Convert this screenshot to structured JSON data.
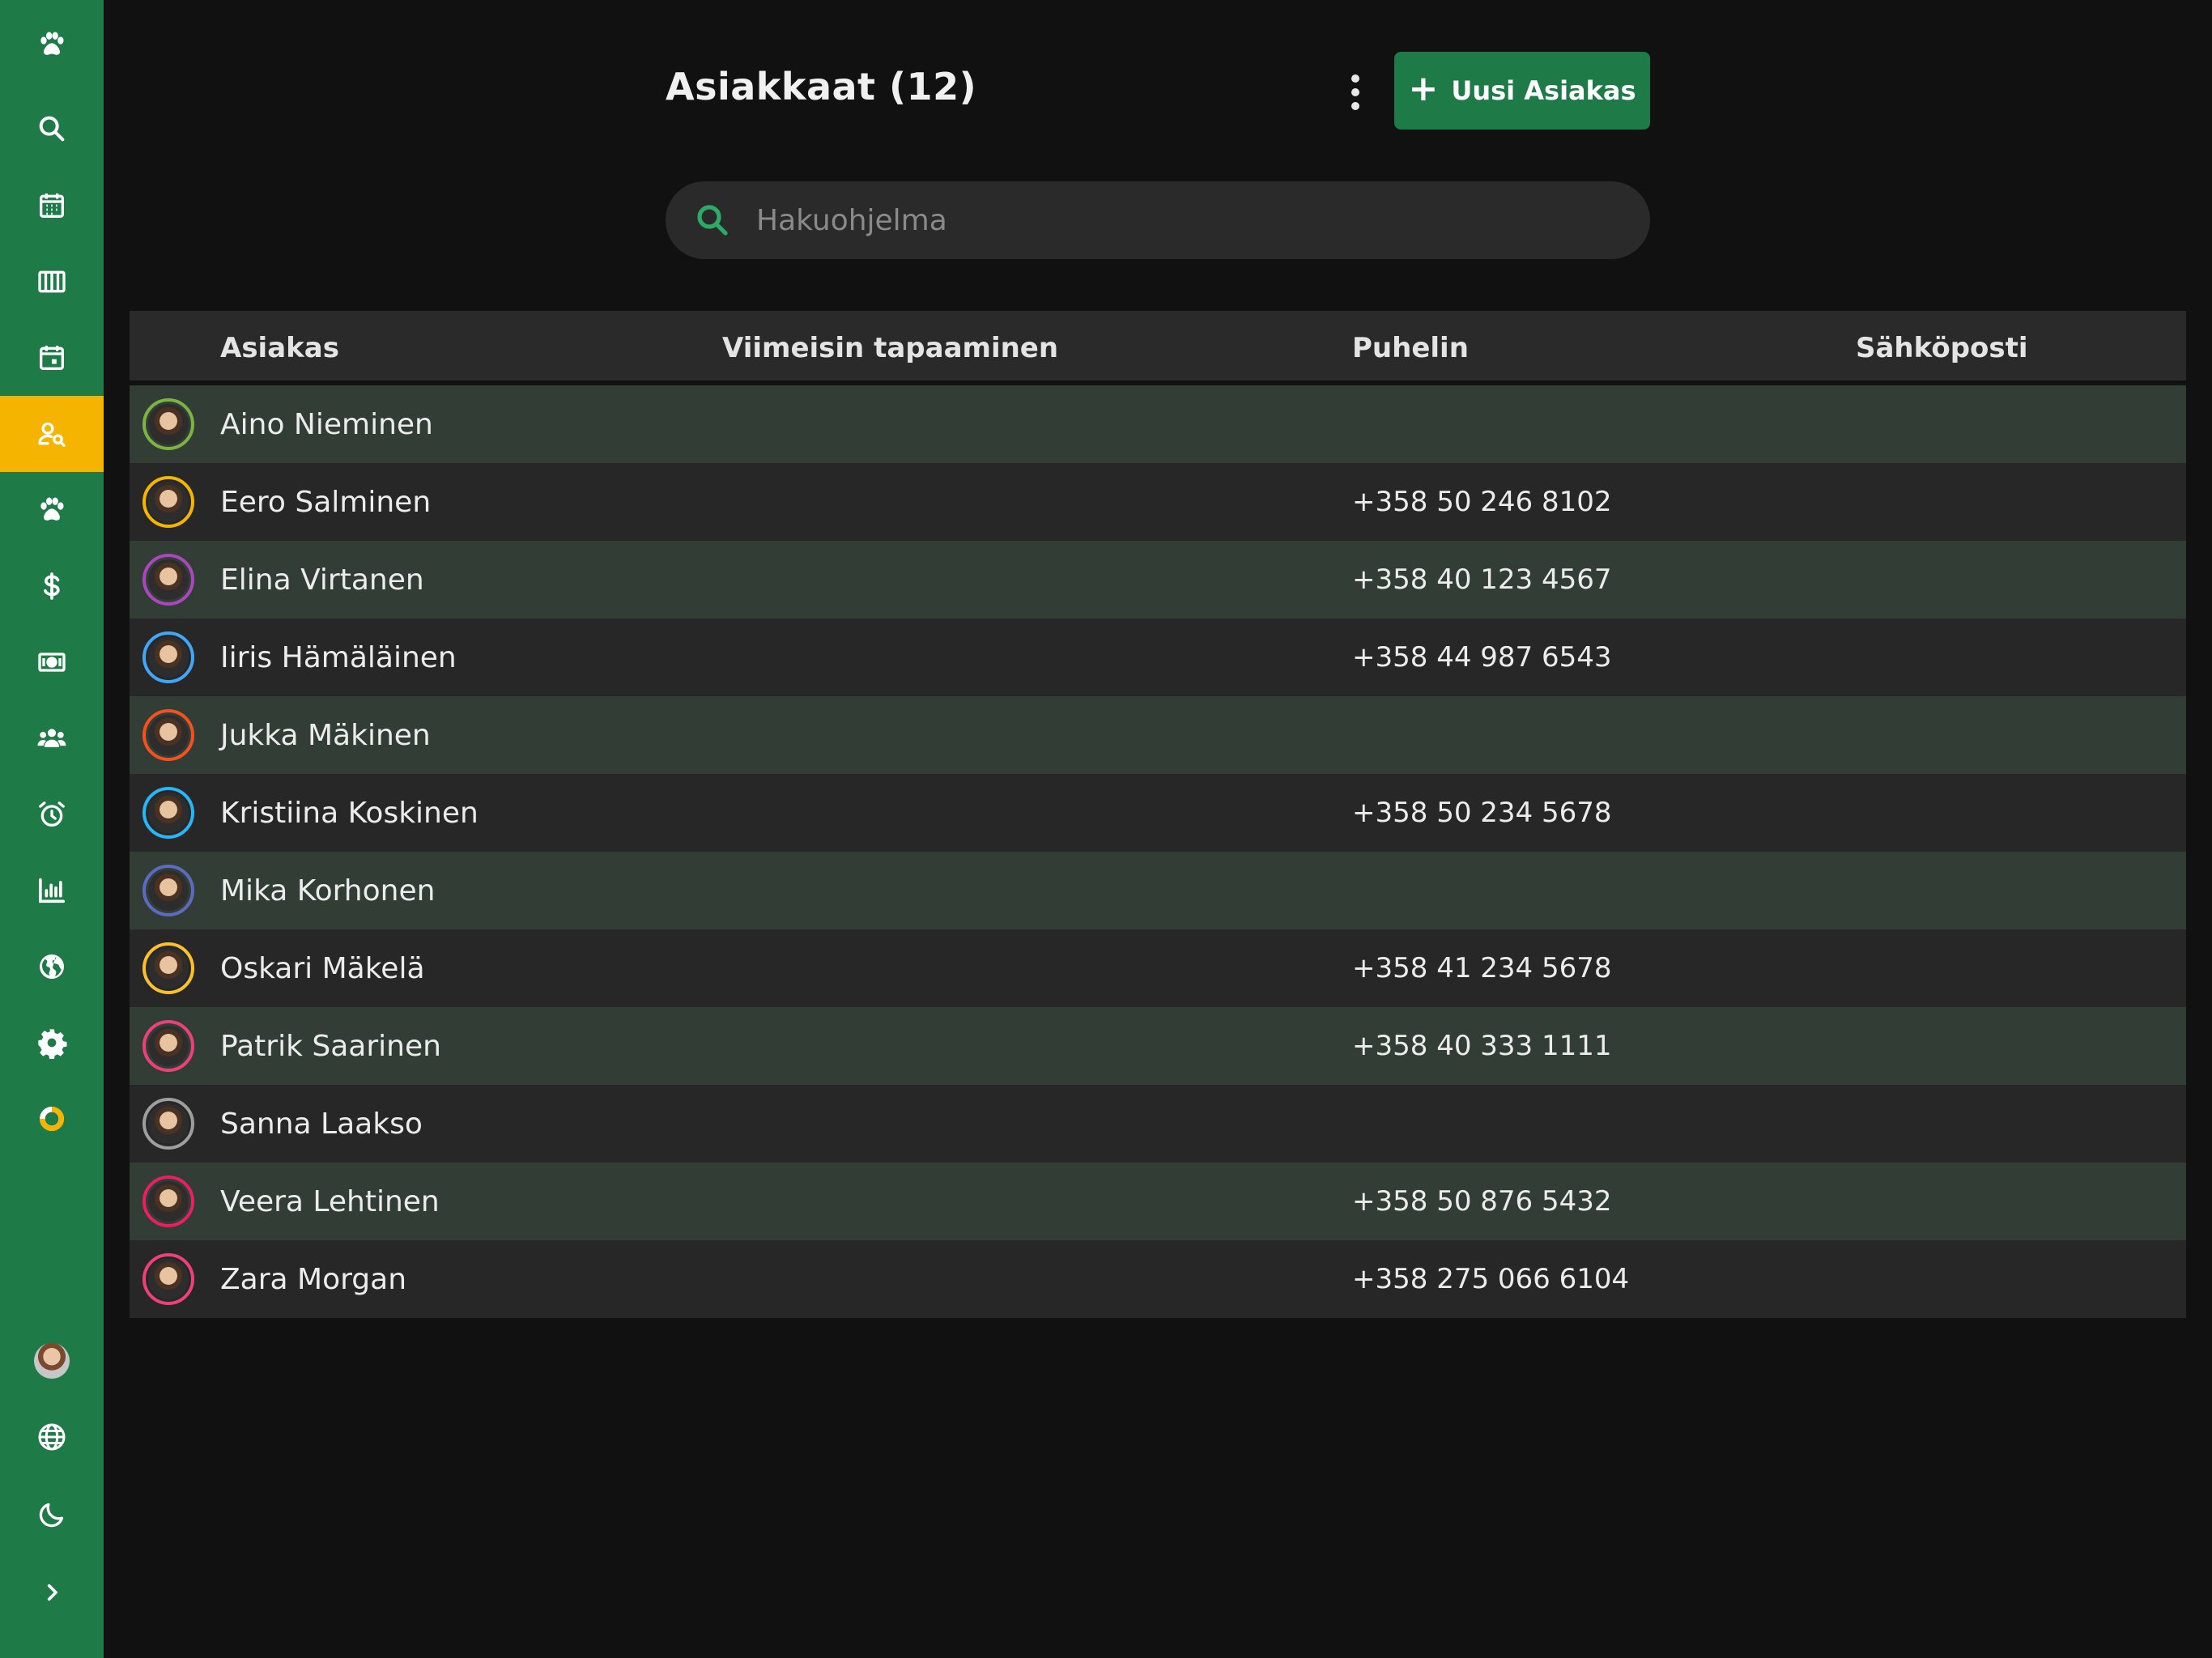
{
  "sidebar": {
    "items": [
      {
        "icon": "paw-icon",
        "name": "nav-logo"
      },
      {
        "icon": "search-icon",
        "name": "nav-search"
      },
      {
        "icon": "calendar-grid-icon",
        "name": "nav-calendar"
      },
      {
        "icon": "columns-icon",
        "name": "nav-board"
      },
      {
        "icon": "calendar-day-icon",
        "name": "nav-appointments"
      },
      {
        "icon": "user-search-icon",
        "name": "nav-customers",
        "active": true
      },
      {
        "icon": "paw-icon",
        "name": "nav-pets"
      },
      {
        "icon": "dollar-icon",
        "name": "nav-billing"
      },
      {
        "icon": "banknote-icon",
        "name": "nav-payments"
      },
      {
        "icon": "users-icon",
        "name": "nav-staff"
      },
      {
        "icon": "alarm-clock-icon",
        "name": "nav-reminders"
      },
      {
        "icon": "bar-chart-icon",
        "name": "nav-reports"
      },
      {
        "icon": "globe-filled-icon",
        "name": "nav-web"
      },
      {
        "icon": "gear-icon",
        "name": "nav-settings"
      },
      {
        "icon": "progress-ring-icon",
        "name": "nav-progress"
      }
    ],
    "bottom": [
      {
        "icon": "avatar",
        "name": "nav-profile"
      },
      {
        "icon": "globe-icon",
        "name": "nav-language"
      },
      {
        "icon": "moon-icon",
        "name": "nav-theme"
      },
      {
        "icon": "chevron-right-icon",
        "name": "nav-expand"
      }
    ]
  },
  "colors": {
    "brand": "#1e7a47",
    "active": "#f4b400",
    "background": "#111111"
  },
  "header": {
    "title": "Asiakkaat (12)",
    "new_button_label": "Uusi Asiakas"
  },
  "search": {
    "placeholder": "Hakuohjelma",
    "value": ""
  },
  "table": {
    "columns": [
      "Asiakas",
      "Viimeisin tapaaminen",
      "Puhelin",
      "Sähköposti"
    ],
    "rows": [
      {
        "name": "Aino Nieminen",
        "last_visit": "",
        "phone": "",
        "email": "",
        "ring": "#7cb342"
      },
      {
        "name": "Eero Salminen",
        "last_visit": "",
        "phone": "+358 50 246 8102",
        "email": "",
        "ring": "#f4b400"
      },
      {
        "name": "Elina Virtanen",
        "last_visit": "",
        "phone": "+358 40 123 4567",
        "email": "",
        "ring": "#ab47bc"
      },
      {
        "name": "Iiris Hämäläinen",
        "last_visit": "",
        "phone": "+358 44 987 6543",
        "email": "",
        "ring": "#42a5f5"
      },
      {
        "name": "Jukka Mäkinen",
        "last_visit": "",
        "phone": "",
        "email": "",
        "ring": "#f4511e"
      },
      {
        "name": "Kristiina Koskinen",
        "last_visit": "",
        "phone": "+358 50 234 5678",
        "email": "",
        "ring": "#29b6f6"
      },
      {
        "name": "Mika Korhonen",
        "last_visit": "",
        "phone": "",
        "email": "",
        "ring": "#5c6bc0"
      },
      {
        "name": "Oskari Mäkelä",
        "last_visit": "",
        "phone": "+358 41 234 5678",
        "email": "",
        "ring": "#fbc02d"
      },
      {
        "name": "Patrik Saarinen",
        "last_visit": "",
        "phone": "+358 40 333 1111",
        "email": "",
        "ring": "#ec407a"
      },
      {
        "name": "Sanna Laakso",
        "last_visit": "",
        "phone": "",
        "email": "",
        "ring": "#9e9e9e"
      },
      {
        "name": "Veera Lehtinen",
        "last_visit": "",
        "phone": "+358 50 876 5432",
        "email": "",
        "ring": "#e91e63"
      },
      {
        "name": "Zara Morgan",
        "last_visit": "",
        "phone": "+358 275 066 6104",
        "email": "",
        "ring": "#ec407a"
      }
    ]
  }
}
